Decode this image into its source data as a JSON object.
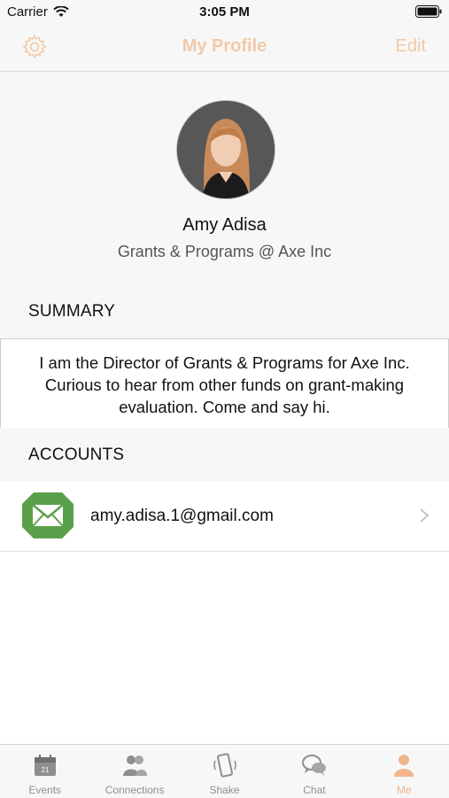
{
  "status_bar": {
    "carrier": "Carrier",
    "time": "3:05 PM"
  },
  "nav": {
    "title": "My Profile",
    "edit_label": "Edit"
  },
  "profile": {
    "name": "Amy Adisa",
    "role": "Grants & Programs @ Axe Inc"
  },
  "summary": {
    "heading": "SUMMARY",
    "text": "I am the Director of Grants & Programs for Axe Inc. Curious to hear from other funds on grant-making evaluation. Come and say hi."
  },
  "accounts": {
    "heading": "ACCOUNTS",
    "items": [
      {
        "email": "amy.adisa.1@gmail.com"
      }
    ]
  },
  "tabbar": {
    "tabs": [
      {
        "label": "Events",
        "icon": "calendar-icon",
        "badge": "21"
      },
      {
        "label": "Connections",
        "icon": "people-icon"
      },
      {
        "label": "Shake",
        "icon": "phone-shake-icon"
      },
      {
        "label": "Chat",
        "icon": "chat-bubbles-icon"
      },
      {
        "label": "Me",
        "icon": "person-icon"
      }
    ],
    "active_index": 4
  },
  "colors": {
    "accent": "#f2c9a6",
    "active_tab": "#f2b58b",
    "mail_green": "#5aa04a"
  }
}
